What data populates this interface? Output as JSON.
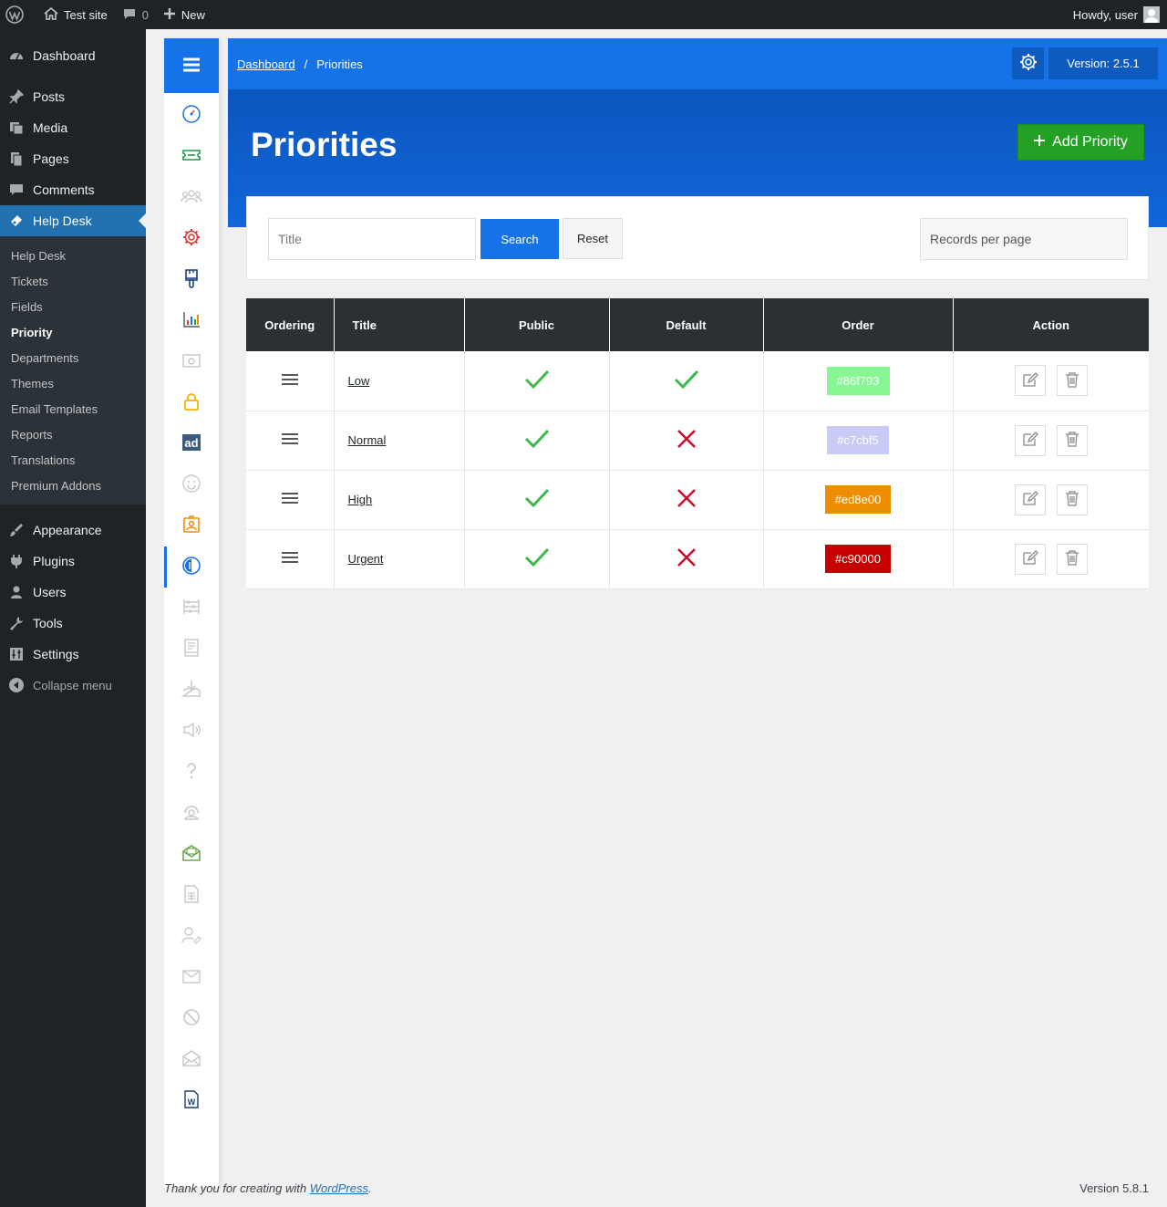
{
  "adminbar": {
    "site_name": "Test site",
    "comments_count": "0",
    "new_label": "New",
    "howdy": "Howdy, user"
  },
  "menu": {
    "items_top": [
      {
        "label": "Dashboard",
        "icon": "dashboard-icon"
      },
      {
        "label": "Posts",
        "icon": "pin-icon"
      },
      {
        "label": "Media",
        "icon": "media-icon"
      },
      {
        "label": "Pages",
        "icon": "pages-icon"
      },
      {
        "label": "Comments",
        "icon": "comment-icon"
      },
      {
        "label": "Help Desk",
        "icon": "ticket-icon"
      }
    ],
    "submenu": [
      "Help Desk",
      "Tickets",
      "Fields",
      "Priority",
      "Departments",
      "Themes",
      "Email Templates",
      "Reports",
      "Translations",
      "Premium Addons"
    ],
    "active_submenu": "Priority",
    "items_bottom": [
      {
        "label": "Appearance",
        "icon": "brush-icon"
      },
      {
        "label": "Plugins",
        "icon": "plug-icon"
      },
      {
        "label": "Users",
        "icon": "user-icon"
      },
      {
        "label": "Tools",
        "icon": "wrench-icon"
      },
      {
        "label": "Settings",
        "icon": "sliders-icon"
      }
    ],
    "collapse": "Collapse menu"
  },
  "breadcrumb": {
    "home": "Dashboard",
    "sep": "/",
    "current": "Priorities"
  },
  "version_badge": "Version: 2.5.1",
  "page": {
    "title": "Priorities",
    "add_button": "Add Priority"
  },
  "filter": {
    "title_placeholder": "Title",
    "search": "Search",
    "reset": "Reset",
    "records_per_page": "Records per page"
  },
  "table": {
    "headers": [
      "Ordering",
      "Title",
      "Public",
      "Default",
      "Order",
      "Action"
    ],
    "rows": [
      {
        "title": "Low",
        "public": true,
        "default": true,
        "color": "#86f793",
        "label": "#86f793"
      },
      {
        "title": "Normal",
        "public": true,
        "default": false,
        "color": "#c7cbf5",
        "label": "#c7cbf5"
      },
      {
        "title": "High",
        "public": true,
        "default": false,
        "color": "#ed8e00",
        "label": "#ed8e00"
      },
      {
        "title": "Urgent",
        "public": true,
        "default": false,
        "color": "#c90000",
        "label": "#c90000"
      }
    ]
  },
  "footer": {
    "thanks_prefix": "Thank you for creating with ",
    "thanks_link": "WordPress",
    "thanks_suffix": ".",
    "version": "Version 5.8.1"
  },
  "colors": {
    "primary": "#1572e8",
    "success": "#24a025",
    "check": "#3cb371",
    "cross": "#c8102e"
  }
}
